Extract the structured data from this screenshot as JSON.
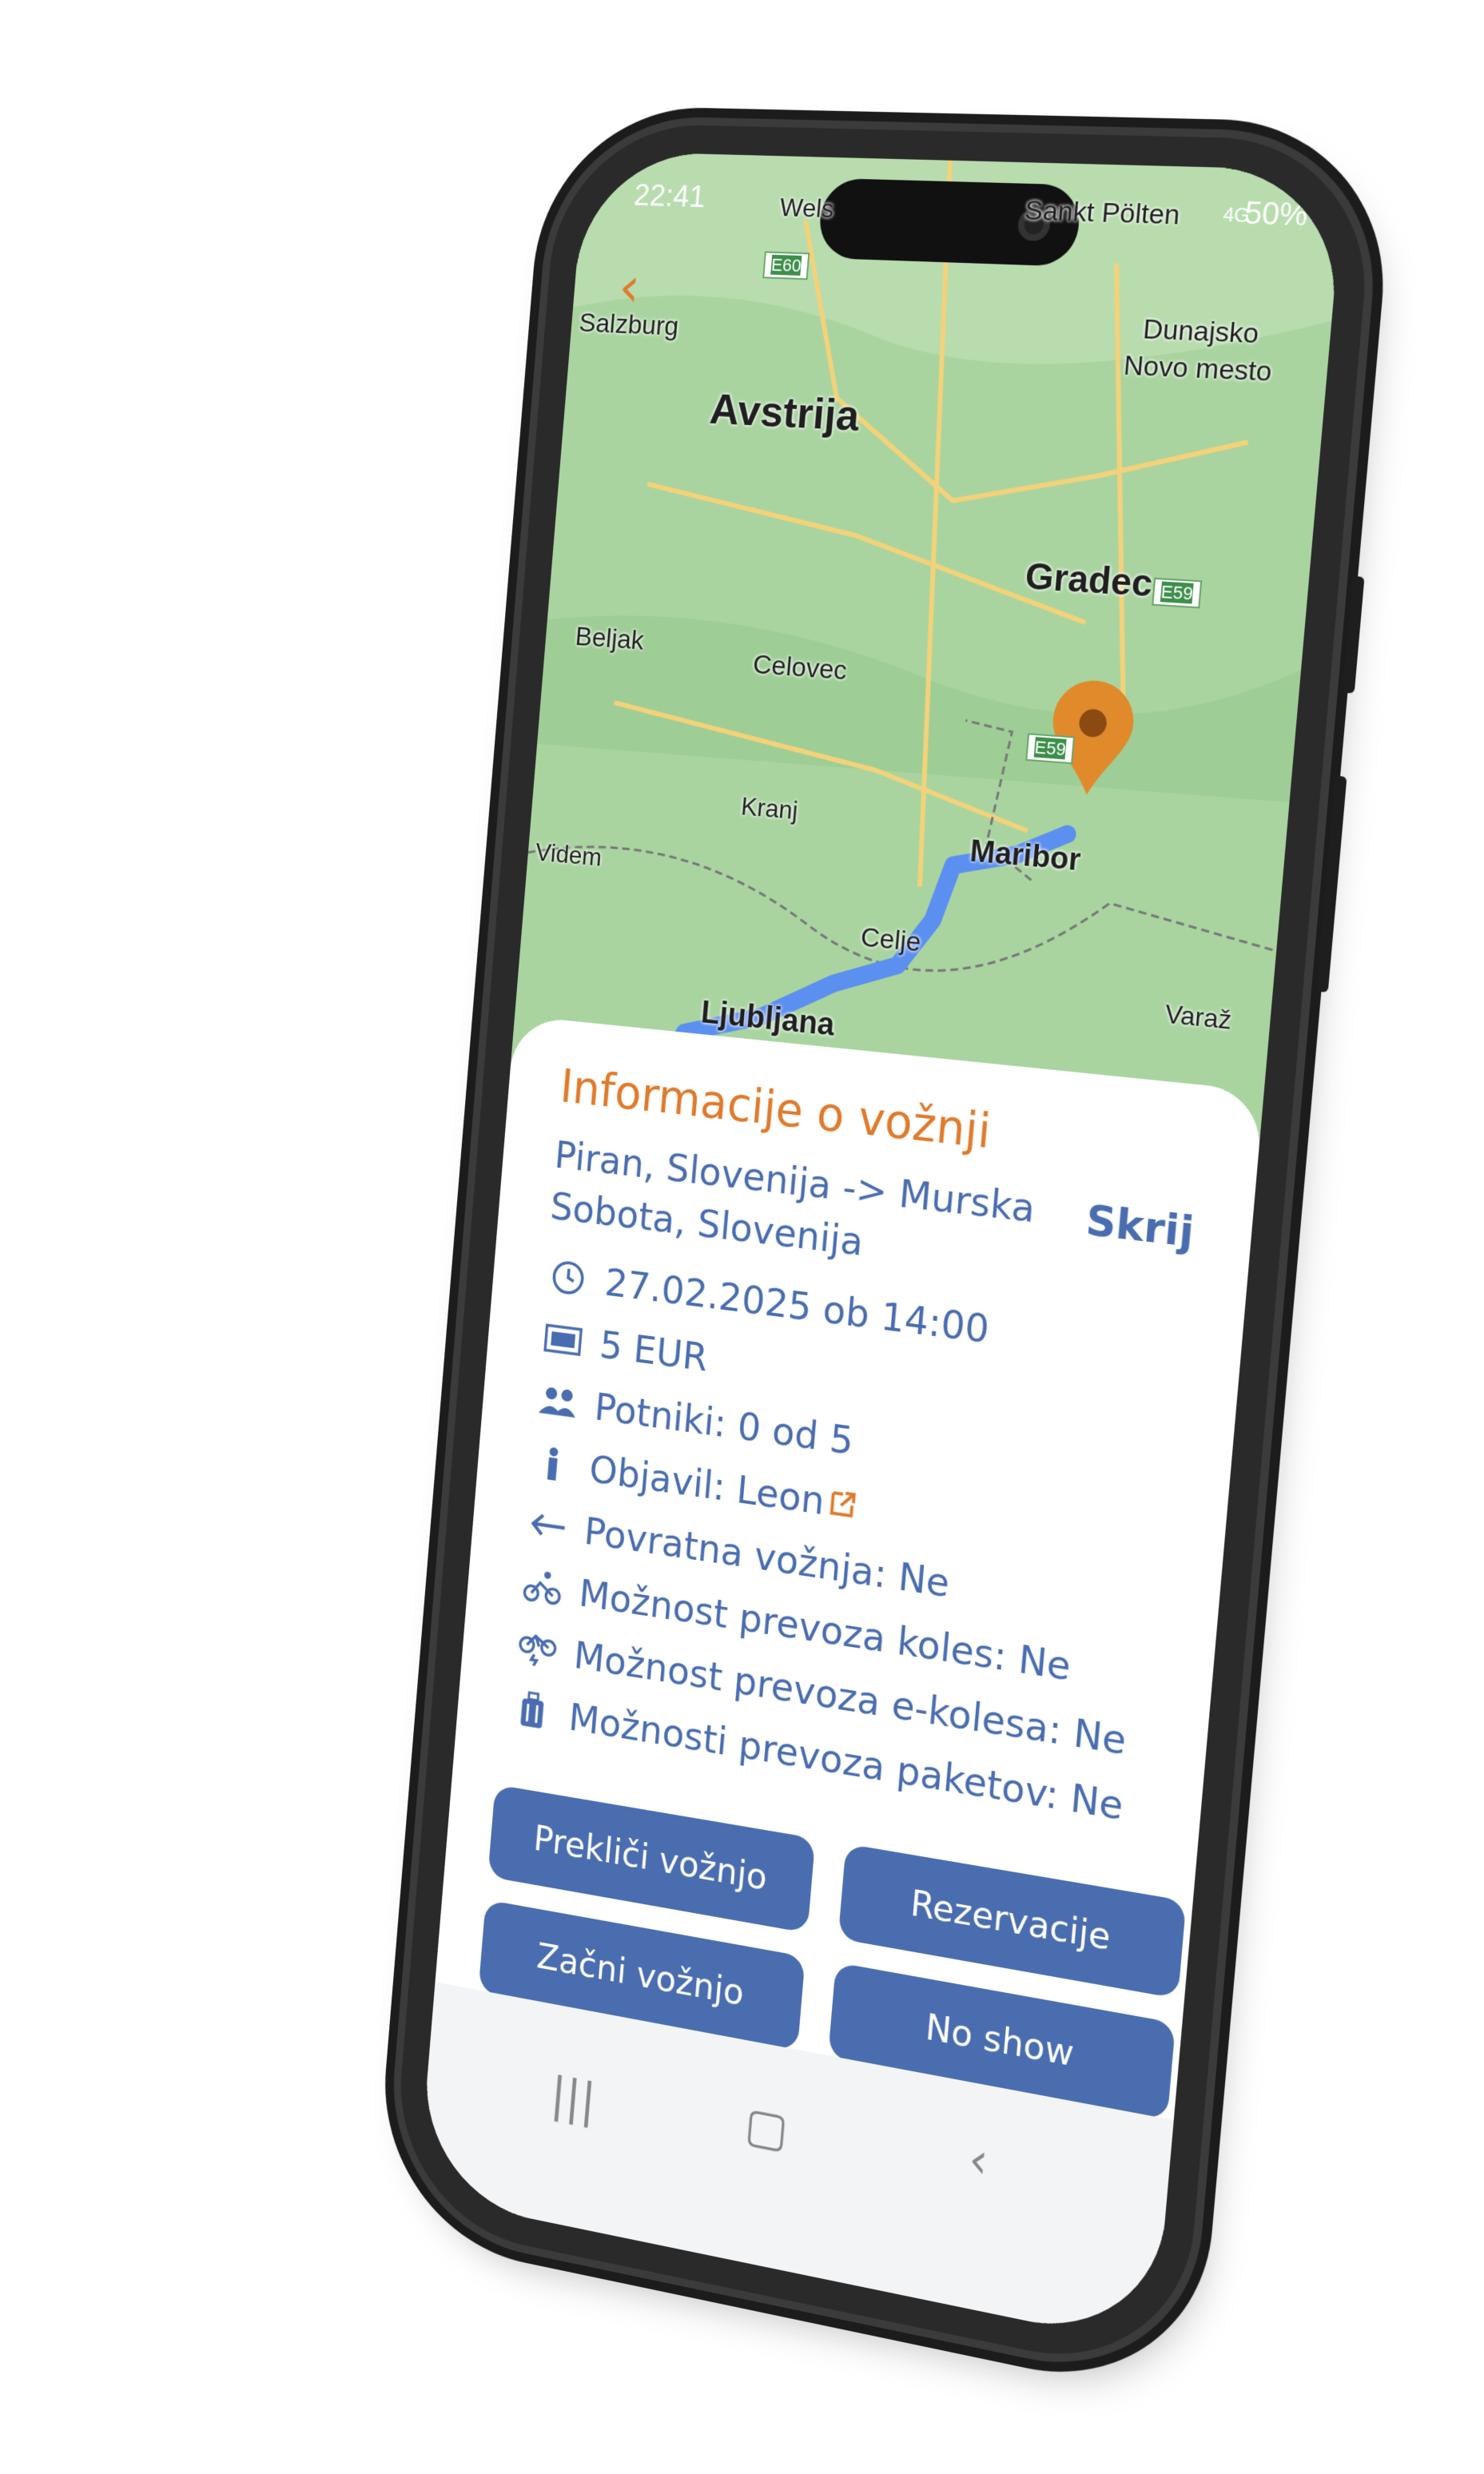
{
  "status_bar": {
    "time": "22:41",
    "battery": "50%",
    "signal": "4G"
  },
  "map": {
    "labels": [
      {
        "text": "Wels",
        "size": 32
      },
      {
        "text": "Sankt Pölten",
        "size": 34
      },
      {
        "text": "Salzburg",
        "size": 34
      },
      {
        "text": "Dunajsko",
        "size": 34
      },
      {
        "text": "Novo mesto",
        "size": 34
      },
      {
        "text": "Avstrija",
        "size": 54
      },
      {
        "text": "Gradec",
        "size": 46
      },
      {
        "text": "Beljak",
        "size": 34
      },
      {
        "text": "Celovec",
        "size": 34
      },
      {
        "text": "Maribor",
        "size": 38
      },
      {
        "text": "Kranj",
        "size": 32
      },
      {
        "text": "Celje",
        "size": 34
      },
      {
        "text": "Videm",
        "size": 32
      },
      {
        "text": "Varaž",
        "size": 32
      },
      {
        "text": "Ljubljana",
        "size": 40
      }
    ],
    "roads": [
      "E60",
      "E59",
      "E59"
    ],
    "route_color": "#5b8ff0",
    "pin_color": "#e08a2c"
  },
  "sheet": {
    "title": "Informacije o vožnji",
    "hide_label": "Skrij",
    "route": "Piran, Slovenija -> Murska Sobota, Slovenija",
    "details": [
      {
        "icon": "clock-icon",
        "text": "27.02.2025 ob 14:00"
      },
      {
        "icon": "banknote-icon",
        "text": "5 EUR"
      },
      {
        "icon": "people-icon",
        "text": "Potniki:  0 od 5"
      },
      {
        "icon": "person-icon",
        "text": "Objavil: Leon"
      },
      {
        "icon": "return-arrow-icon",
        "text": "Povratna vožnja:  Ne"
      },
      {
        "icon": "bicycle-icon",
        "text": "Možnost prevoza koles: Ne"
      },
      {
        "icon": "ebike-icon",
        "text": "Možnost prevoza e-kolesa: Ne"
      },
      {
        "icon": "luggage-icon",
        "text": "Možnosti prevoza paketov: Ne"
      }
    ],
    "buttons": {
      "cancel": "Prekliči vožnjo",
      "reservations": "Rezervacije",
      "start": "Začni vožnjo",
      "no_show": "No show"
    }
  },
  "colors": {
    "accent": "#e07b2c",
    "primary": "#4a6db0"
  }
}
